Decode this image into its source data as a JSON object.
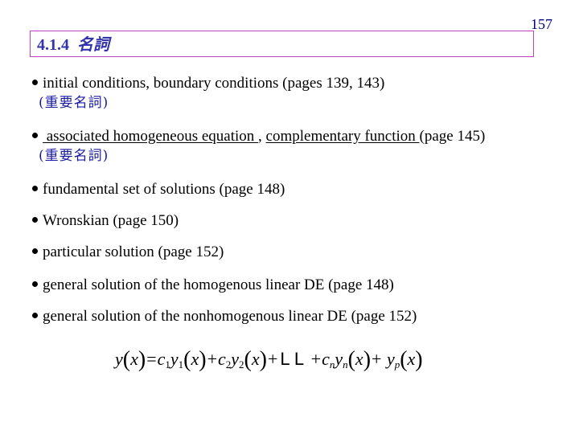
{
  "page_number": "157",
  "header": {
    "section_number": "4.1.4",
    "section_title": "名詞"
  },
  "items": [
    {
      "text": "initial conditions, boundary conditions (pages 139, 143)",
      "note": "(重要名詞)"
    },
    {
      "underlined_1": " associated homogeneous equation ",
      "separator": ", ",
      "underlined_2": "complementary function ",
      "suffix": "(page 145)",
      "note": "(重要名詞)"
    },
    {
      "text": "fundamental set of solutions (page 148)"
    },
    {
      "text": "Wronskian (page 150)"
    },
    {
      "text": "particular solution (page 152)"
    },
    {
      "text": "general solution of the homogenous linear DE (page 148)"
    },
    {
      "text": "general solution of the nonhomogenous linear DE (page 152)"
    }
  ],
  "formula": {
    "lhs_fn": "y",
    "arg": "x",
    "equals": "=",
    "c": "c",
    "y": "y",
    "sub_1": "1",
    "sub_2": "2",
    "sub_n": "n",
    "sub_p": "p",
    "plus": "+",
    "ellipsis": "L L",
    "open_paren": "(",
    "close_paren": ")"
  }
}
